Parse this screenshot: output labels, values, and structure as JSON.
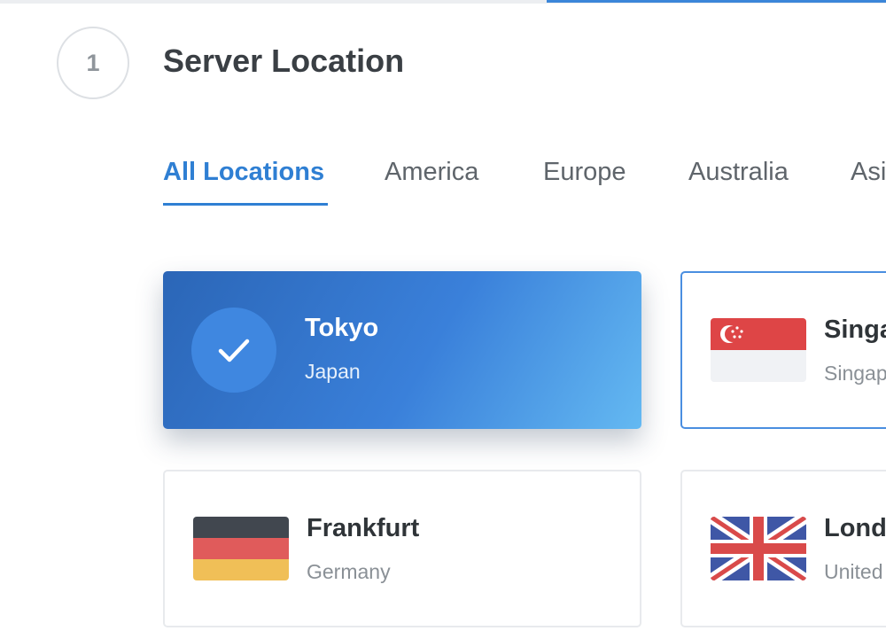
{
  "step": {
    "number": "1",
    "title": "Server Location"
  },
  "tabs": [
    {
      "label": "All Locations",
      "active": true
    },
    {
      "label": "America",
      "active": false
    },
    {
      "label": "Europe",
      "active": false
    },
    {
      "label": "Australia",
      "active": false
    },
    {
      "label": "Asi",
      "active": false
    }
  ],
  "locations": [
    {
      "city": "Tokyo",
      "country": "Japan",
      "selected": true,
      "icon": "check-icon"
    },
    {
      "city": "Singa",
      "country": "Singap",
      "selected": false,
      "flag": "singapore-flag-icon"
    },
    {
      "city": "Frankfurt",
      "country": "Germany",
      "selected": false,
      "flag": "germany-flag-icon"
    },
    {
      "city": "Lond",
      "country": "United",
      "selected": false,
      "flag": "uk-flag-icon"
    }
  ],
  "colors": {
    "accent": "#2f7fd3",
    "selected_gradient_start": "#2b66b7",
    "selected_gradient_end": "#64b9f2",
    "text_dark": "#3a3f44",
    "text_muted": "#8a9096"
  }
}
